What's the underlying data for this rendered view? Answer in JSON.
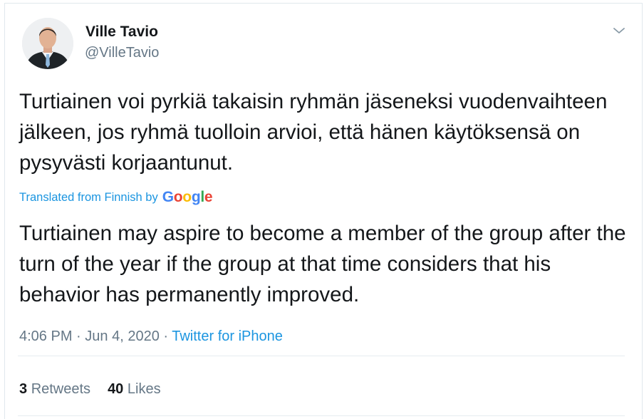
{
  "author": {
    "name": "Ville Tavio",
    "handle": "@VilleTavio"
  },
  "tweet": {
    "original_text": "Turtiainen voi pyrkiä takaisin ryhmän jäseneksi vuodenvaihteen jälkeen, jos ryhmä tuolloin arvioi, että hänen käytöksensä on pysyvästi korjaantunut.",
    "translation_label": "Translated from Finnish by",
    "translation_provider": "Google",
    "translated_text": "Turtiainen may aspire to become a member of the group after the turn of the year if the group at that time considers that his behavior has permanently improved.",
    "time": "4:06 PM",
    "date": "Jun 4, 2020",
    "separator": "·",
    "source": "Twitter for iPhone"
  },
  "stats": {
    "retweets_count": "3",
    "retweets_label": "Retweets",
    "likes_count": "40",
    "likes_label": "Likes"
  },
  "colors": {
    "link_blue": "#1b95e0",
    "muted_gray": "#657786",
    "text_dark": "#14171a"
  },
  "icons": {
    "menu": "chevron-down-icon"
  }
}
